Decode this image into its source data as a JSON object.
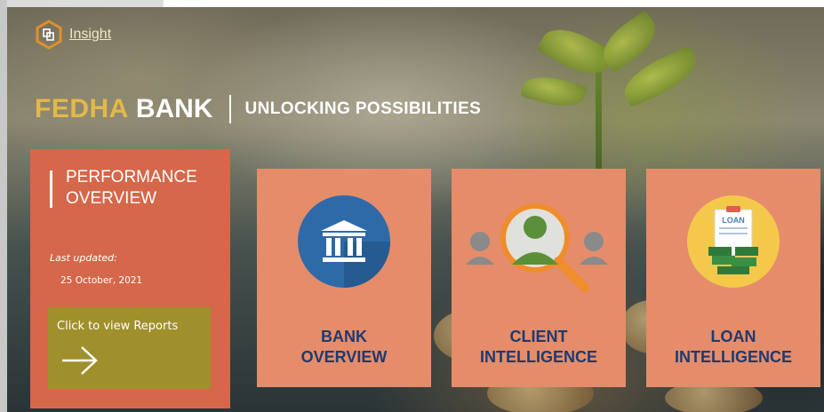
{
  "app": {
    "logo_text": "Insight",
    "brand_name_part1": "FEDHA",
    "brand_name_part2": "BANK",
    "tagline": "UNLOCKING POSSIBILITIES"
  },
  "performance": {
    "title": "PERFORMANCE OVERVIEW",
    "last_updated_label": "Last updated:",
    "last_updated_date": "25 October, 2021",
    "reports_label": "Click to view Reports"
  },
  "cards": [
    {
      "label_line1": "BANK",
      "label_line2": "OVERVIEW",
      "icon": "bank-icon"
    },
    {
      "label_line1": "CLIENT",
      "label_line2": "INTELLIGENCE",
      "icon": "client-search-icon"
    },
    {
      "label_line1": "LOAN",
      "label_line2": "INTELLIGENCE",
      "icon": "loan-icon"
    }
  ],
  "loan_icon_text": "LOAN",
  "colors": {
    "accent_orange": "#d5674a",
    "card_salmon": "#e58c6a",
    "reports_olive": "#a0902b",
    "brand_gold": "#e3b84a",
    "label_navy": "#1f3a6e"
  }
}
